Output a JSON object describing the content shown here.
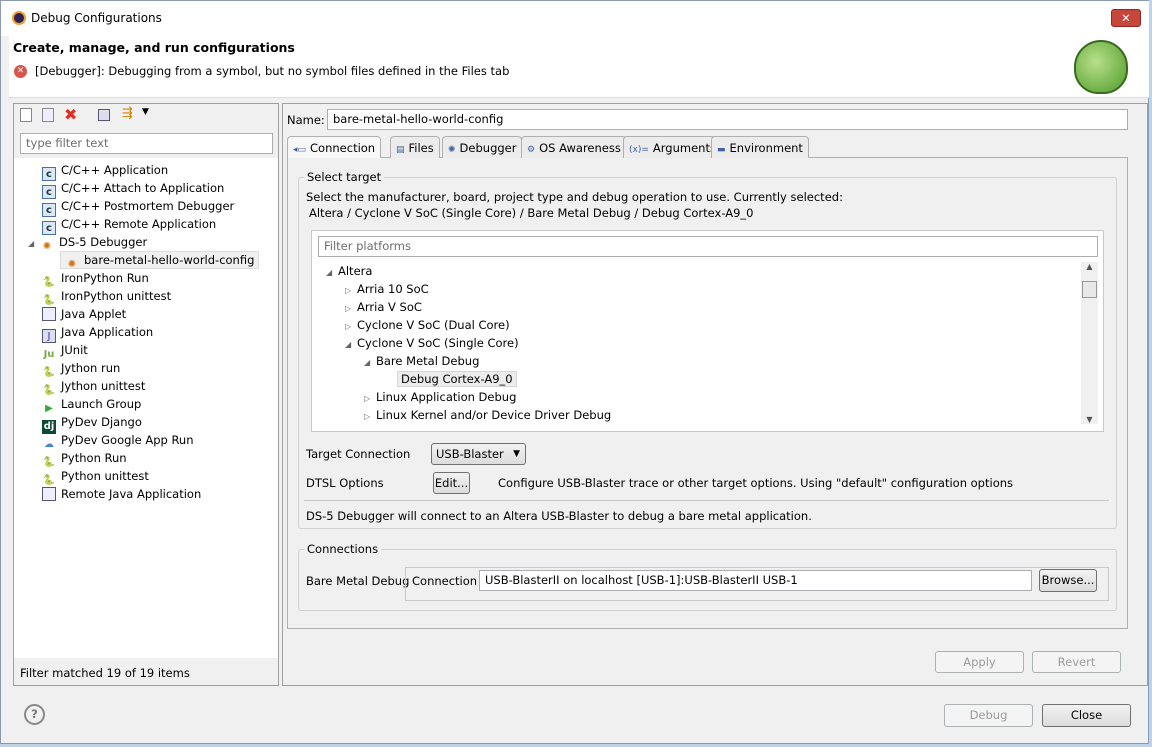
{
  "window": {
    "title": "Debug Configurations"
  },
  "header": {
    "title": "Create, manage, and run configurations",
    "error": "[Debugger]: Debugging from a symbol, but no symbol files defined in the Files tab"
  },
  "left": {
    "filter_placeholder": "type filter text",
    "status": "Filter matched 19 of 19 items",
    "items": [
      {
        "label": "C/C++ Application",
        "icon": "c-icon"
      },
      {
        "label": "C/C++ Attach to Application",
        "icon": "c-icon"
      },
      {
        "label": "C/C++ Postmortem Debugger",
        "icon": "c-icon"
      },
      {
        "label": "C/C++ Remote Application",
        "icon": "c-icon"
      },
      {
        "label": "DS-5 Debugger",
        "icon": "ds5-icon"
      },
      {
        "label": "bare-metal-hello-world-config",
        "icon": "ds5-icon"
      },
      {
        "label": "IronPython Run",
        "icon": "python-icon"
      },
      {
        "label": "IronPython unittest",
        "icon": "python-icon"
      },
      {
        "label": "Java Applet",
        "icon": "applet-icon"
      },
      {
        "label": "Java Application",
        "icon": "java-icon"
      },
      {
        "label": "JUnit",
        "icon": "junit-icon"
      },
      {
        "label": "Jython run",
        "icon": "python-icon"
      },
      {
        "label": "Jython unittest",
        "icon": "python-icon"
      },
      {
        "label": "Launch Group",
        "icon": "launch-icon"
      },
      {
        "label": "PyDev Django",
        "icon": "django-icon"
      },
      {
        "label": "PyDev Google App Run",
        "icon": "google-icon"
      },
      {
        "label": "Python Run",
        "icon": "python-icon"
      },
      {
        "label": "Python unittest",
        "icon": "python-icon"
      },
      {
        "label": "Remote Java Application",
        "icon": "remote-java-icon"
      }
    ]
  },
  "main": {
    "name_label": "Name:",
    "name_value": "bare-metal-hello-world-config",
    "tabs": [
      "Connection",
      "Files",
      "Debugger",
      "OS Awareness",
      "Arguments",
      "Environment"
    ],
    "select_target": {
      "label": "Select target",
      "desc": "Select the manufacturer, board, project type and debug operation to use. Currently selected:",
      "current": "Altera / Cyclone V SoC (Single Core) / Bare Metal Debug / Debug Cortex-A9_0",
      "filter_placeholder": "Filter platforms",
      "tree": [
        "Altera",
        "Arria 10 SoC",
        "Arria V SoC",
        "Cyclone V SoC (Dual Core)",
        "Cyclone V SoC (Single Core)",
        "Bare Metal Debug",
        "Debug Cortex-A9_0",
        "Linux Application Debug",
        "Linux Kernel and/or Device Driver Debug"
      ]
    },
    "target_connection_label": "Target Connection",
    "target_connection_value": "USB-Blaster",
    "dtsl_label": "DTSL Options",
    "edit_button": "Edit...",
    "dtsl_desc": "Configure USB-Blaster trace or other target options. Using \"default\" configuration options",
    "info": "DS-5 Debugger will connect to an Altera USB-Blaster to debug a bare metal application.",
    "connections": {
      "label": "Connections",
      "bare_metal_label": "Bare Metal Debug",
      "connection_label": "Connection",
      "connection_value": "USB-BlasterII on localhost [USB-1]:USB-BlasterII USB-1",
      "browse": "Browse..."
    },
    "apply": "Apply",
    "revert": "Revert"
  },
  "footer": {
    "debug": "Debug",
    "close": "Close"
  }
}
